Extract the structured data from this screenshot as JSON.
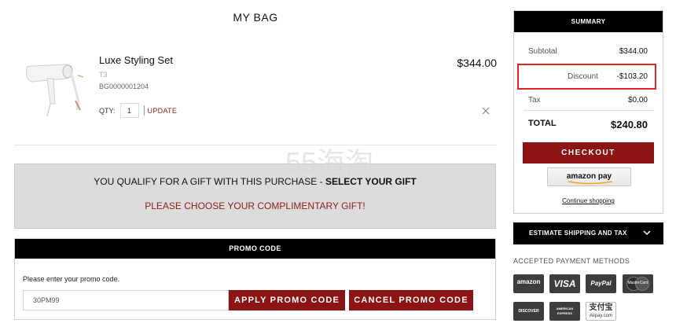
{
  "page": {
    "title": "MY BAG"
  },
  "item": {
    "name": "Luxe Styling Set",
    "brand": "T3",
    "sku": "BG0000001204",
    "price": "$344.00",
    "qty_label": "QTY:",
    "qty_value": "1",
    "update_label": "UPDATE",
    "remove_icon": "close-icon"
  },
  "gift": {
    "line1_prefix": "YOU QUALIFY FOR A GIFT WITH THIS PURCHASE -",
    "line1_link": "SELECT YOUR GIFT",
    "line2": "PLEASE CHOOSE YOUR COMPLIMENTARY GIFT!"
  },
  "promo": {
    "header": "PROMO CODE",
    "hint": "Please enter your promo code.",
    "input_value": "30PM99",
    "apply_label": "APPLY PROMO CODE",
    "cancel_label": "CANCEL PROMO CODE"
  },
  "summary": {
    "header": "SUMMARY",
    "subtotal_label": "Subtotal",
    "subtotal_value": "$344.00",
    "discount_label": "Discount",
    "discount_value": "-$103.20",
    "tax_label": "Tax",
    "tax_value": "$0.00",
    "total_label": "TOTAL",
    "total_value": "$240.80",
    "checkout_label": "CHECKOUT",
    "amazon_pay_label": "amazon pay",
    "continue_label": "Continue shopping"
  },
  "shipping": {
    "label": "ESTIMATE SHIPPING AND TAX",
    "icon": "chevron-down-icon"
  },
  "payment": {
    "title": "ACCEPTED PAYMENT METHODS",
    "amazon": "amazon",
    "visa": "VISA",
    "paypal": "PayPal",
    "mastercard": "MasterCard",
    "discover": "DISCOVER",
    "amex_line1": "AMERICAN",
    "amex_line2": "EXPRESS",
    "alipay_cn": "支付宝",
    "alipay_en": "Alipay.com"
  },
  "watermark": {
    "text": "55海淘"
  },
  "colors": {
    "brand_red": "#8c1414",
    "highlight_red": "#e02424",
    "gift_bg": "#dcdcdc"
  }
}
